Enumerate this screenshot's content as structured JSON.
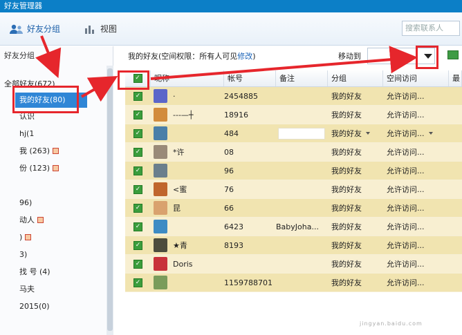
{
  "window": {
    "title": "好友管理器"
  },
  "toolbar": {
    "friend_groups": "好友分组",
    "view": "视图",
    "search_placeholder": "搜索联系人"
  },
  "sidebar": {
    "header": "好友分组",
    "items": [
      {
        "label": "全部好友(672)"
      },
      {
        "label": "我的好友(80)",
        "selected": true
      },
      {
        "label": "认识"
      },
      {
        "label": "hj(1"
      },
      {
        "label": "我        (263)",
        "badge": true
      },
      {
        "label": "        份 (123)",
        "badge": true
      },
      {
        "label": ""
      },
      {
        "label": "96)"
      },
      {
        "label": "动人",
        "badge": true
      },
      {
        "label": ")",
        "badge": true
      },
      {
        "label": "3)"
      },
      {
        "label": "找      号 (4)"
      },
      {
        "label": "马夫"
      },
      {
        "label": "2015(0)"
      }
    ]
  },
  "main": {
    "breadcrumb_group": "我的好友(空间权限：所有人可见",
    "modify_link": "修改",
    "breadcrumb_close": ")",
    "move_to_label": "移动到",
    "columns": [
      "昵称",
      "帐号",
      "备注",
      "分组",
      "空间访问",
      "最"
    ],
    "rows": [
      {
        "nickname": "·",
        "account": "2454885",
        "remark": "",
        "group": "我的好友",
        "space": "允许访问...",
        "avatar": "#5b66c9"
      },
      {
        "nickname": "---—┼",
        "account": "18916",
        "remark": "",
        "group": "我的好友",
        "space": "允许访问...",
        "avatar": "#d28c3c"
      },
      {
        "nickname": "",
        "account": "484",
        "remark": "",
        "group": "我的好友",
        "space": "允许访问...",
        "avatar": "#4a7fa8",
        "hover": true
      },
      {
        "nickname": "*许",
        "account": "08",
        "remark": "",
        "group": "我的好友",
        "space": "允许访问...",
        "avatar": "#9a8a78"
      },
      {
        "nickname": "",
        "account": "96",
        "remark": "",
        "group": "我的好友",
        "space": "允许访问...",
        "avatar": "#6b7f8c"
      },
      {
        "nickname": "<蜜",
        "account": "76",
        "remark": "",
        "group": "我的好友",
        "space": "允许访问...",
        "avatar": "#c0662d"
      },
      {
        "nickname": "昆",
        "account": "66",
        "remark": "",
        "group": "我的好友",
        "space": "允许访问...",
        "avatar": "#d9a26e"
      },
      {
        "nickname": "",
        "account": "6423",
        "remark": "BabyJoha...",
        "group": "我的好友",
        "space": "允许访问...",
        "avatar": "#3d8bc4"
      },
      {
        "nickname": "★青",
        "account": "8193",
        "remark": "",
        "group": "我的好友",
        "space": "允许访问...",
        "avatar": "#4c4c3d"
      },
      {
        "nickname": "Doris",
        "account": "",
        "remark": "",
        "group": "我的好友",
        "space": "允许访问...",
        "avatar": "#c8323a"
      },
      {
        "nickname": "",
        "account": "1159788701",
        "remark": "",
        "group": "我的好友",
        "space": "允许访问...",
        "avatar": "#7a9c5b"
      }
    ]
  },
  "colors": {
    "accent": "#2f86d6",
    "row_bg": "#f1e4b0",
    "annotation": "#e6262c"
  },
  "watermark": {
    "text": "Bai度",
    "sub": "jingyan.baidu.com"
  }
}
